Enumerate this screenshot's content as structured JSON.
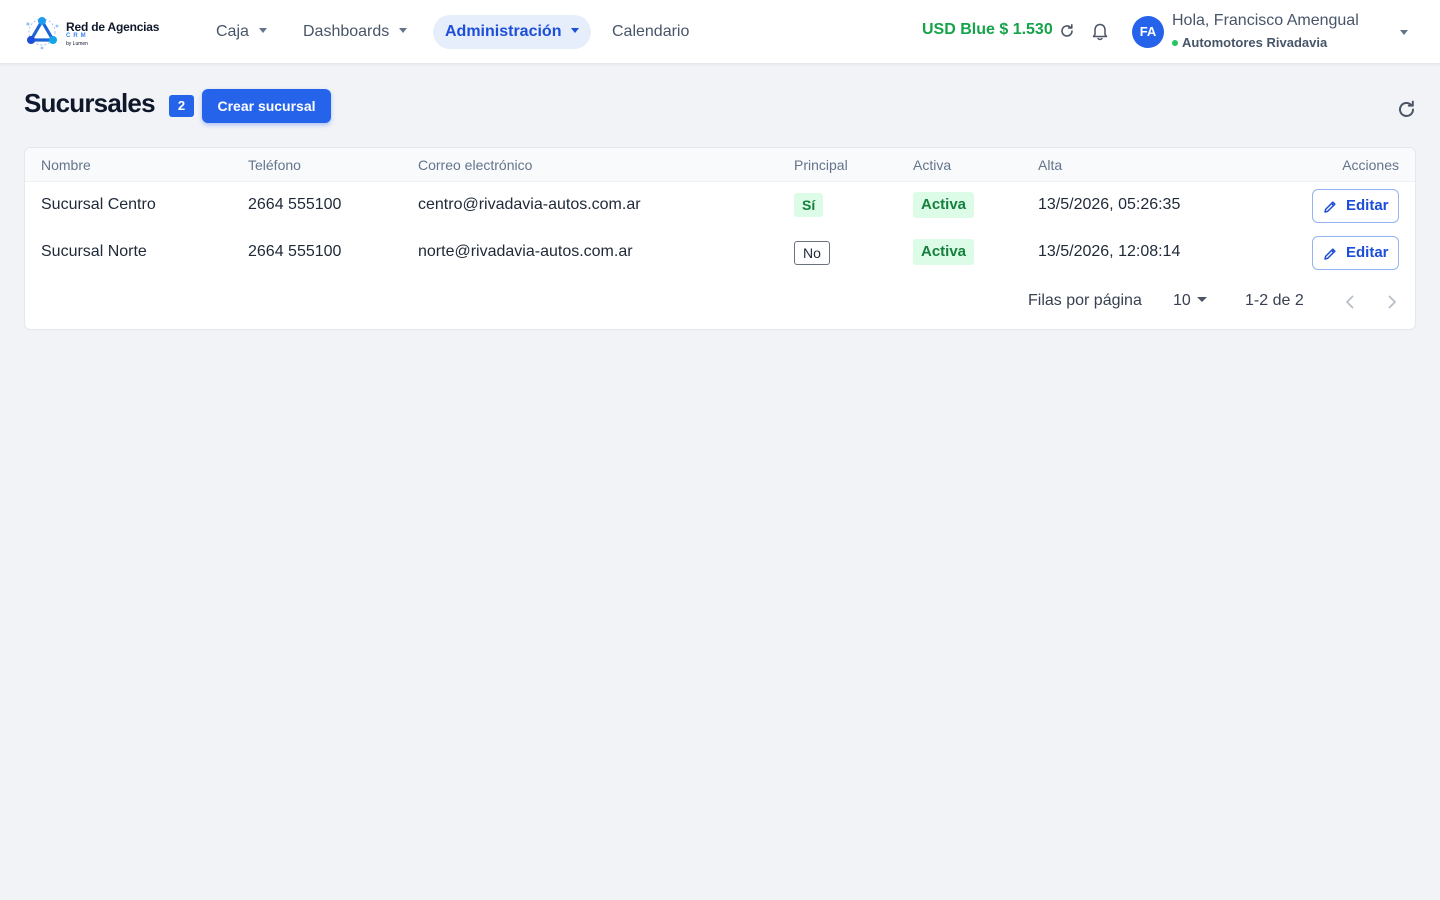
{
  "header": {
    "logo": {
      "brand": "Red de Agencias",
      "sub": "CRM",
      "by": "by Lumen"
    },
    "nav": [
      {
        "label": "Caja",
        "has_dropdown": true,
        "active": false
      },
      {
        "label": "Dashboards",
        "has_dropdown": true,
        "active": false
      },
      {
        "label": "Administración",
        "has_dropdown": true,
        "active": true
      },
      {
        "label": "Calendario",
        "has_dropdown": false,
        "active": false
      }
    ],
    "usd_rate": "USD Blue $ 1.530",
    "user": {
      "initials": "FA",
      "greeting": "Hola, Francisco Amengual",
      "agency": "Automotores Rivadavia"
    },
    "icons": [
      "refresh-icon",
      "bell-icon",
      "chevron-down-icon"
    ]
  },
  "page": {
    "title": "Sucursales",
    "count": "2",
    "create_label": "Crear sucursal"
  },
  "table": {
    "columns": [
      "Nombre",
      "Teléfono",
      "Correo electrónico",
      "Principal",
      "Activa",
      "Alta",
      "Acciones"
    ],
    "rows": [
      {
        "nombre": "Sucursal Centro",
        "telefono": "2664 555100",
        "correo": "centro@rivadavia-autos.com.ar",
        "principal": "Sí",
        "activa": "Activa",
        "alta": "13/5/2026, 05:26:35",
        "accion": "Editar"
      },
      {
        "nombre": "Sucursal Norte",
        "telefono": "2664 555100",
        "correo": "norte@rivadavia-autos.com.ar",
        "principal": "No",
        "activa": "Activa",
        "alta": "13/5/2026, 12:08:14",
        "accion": "Editar"
      }
    ]
  },
  "pagination": {
    "rows_label": "Filas por página",
    "rows_value": "10",
    "range": "1-2 de 2"
  },
  "colors": {
    "accent": "#2563eb",
    "success": "#16a34a",
    "background": "#f1f3f7"
  }
}
